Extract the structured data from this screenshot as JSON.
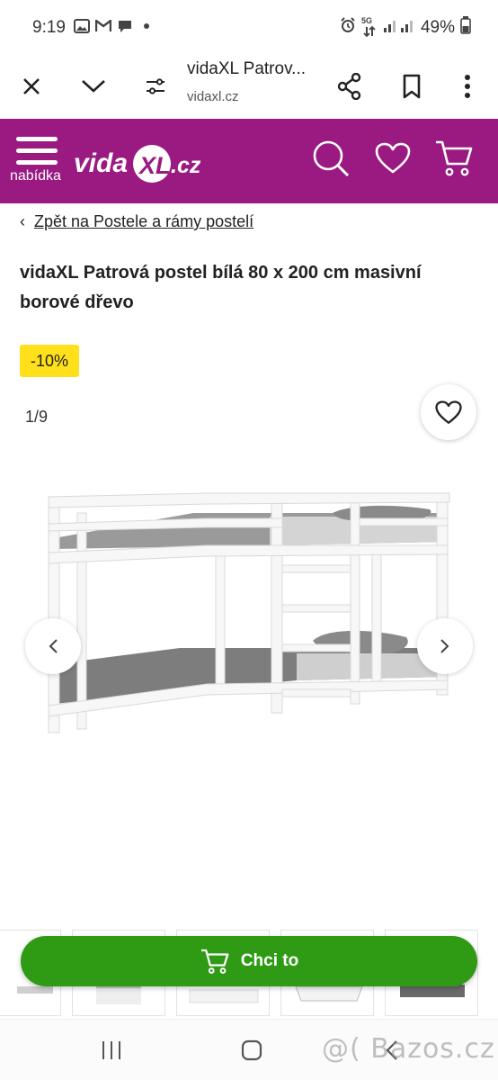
{
  "status_bar": {
    "time": "9:19",
    "network": "5G",
    "battery": "49%",
    "icons": [
      "gallery-icon",
      "gmail-icon",
      "chat-icon",
      "dot-icon",
      "alarm-icon",
      "wifi-icon",
      "signal-icon",
      "battery-icon"
    ]
  },
  "browser": {
    "title": "vidaXL Patrov...",
    "url": "vidaxl.cz",
    "icons": [
      "close-icon",
      "chevron-down-icon",
      "tune-icon",
      "share-icon",
      "bookmark-icon",
      "more-vert-icon"
    ]
  },
  "header": {
    "menu_label": "nabídka",
    "logo_text_main": "vida",
    "logo_text_xl": "XL",
    "logo_text_tld": ".cz",
    "icons": [
      "search-icon",
      "heart-icon",
      "cart-icon"
    ],
    "brand_color": "#9a1a82"
  },
  "breadcrumb": {
    "arrow": "‹",
    "link": "Zpět na Postele a rámy postelí"
  },
  "product": {
    "title": "vidaXL Patrová postel bílá 80 x 200 cm masivní borové dřevo",
    "discount": "-10%",
    "image_counter": "1/9",
    "discount_color": "#ffe01a"
  },
  "cta": {
    "label": "Chci to",
    "color": "#2f9b14"
  },
  "watermark": "@( Bazos.cz"
}
